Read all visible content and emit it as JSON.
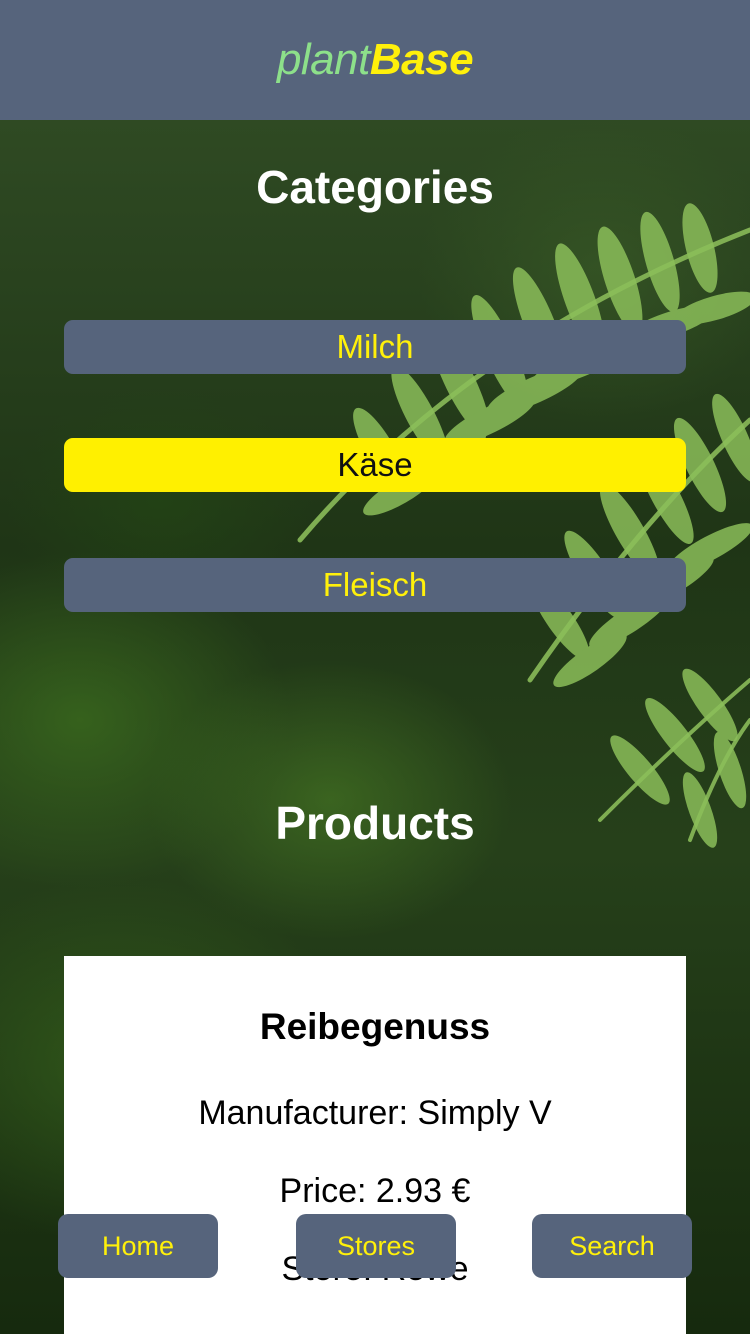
{
  "header": {
    "logo_part1": "plant",
    "logo_part2": "Base"
  },
  "categories": {
    "title": "Categories",
    "items": [
      {
        "label": "Milch",
        "active": false
      },
      {
        "label": "Käse",
        "active": true
      },
      {
        "label": "Fleisch",
        "active": false
      }
    ]
  },
  "products": {
    "title": "Products",
    "items": [
      {
        "name": "Reibegenuss",
        "manufacturer": "Manufacturer: Simply V",
        "price": "Price: 2.93 €",
        "store": "Store: Rewe"
      }
    ]
  },
  "nav": {
    "home": "Home",
    "stores": "Stores",
    "search": "Search"
  },
  "colors": {
    "header_bg": "#56647c",
    "accent_yellow": "#fff00a",
    "logo_green": "#8de08a",
    "active_bg": "#fff000"
  }
}
